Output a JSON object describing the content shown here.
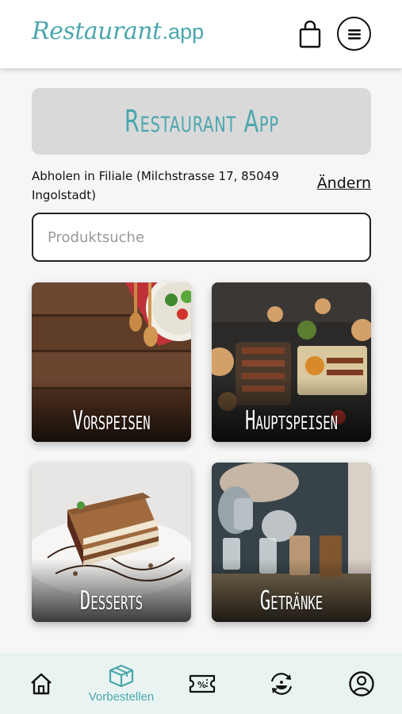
{
  "header": {
    "logo_main": "Restaurant",
    "logo_suffix": ".app",
    "cart_icon": "shopping-bag-icon",
    "menu_icon": "hamburger-menu-icon"
  },
  "banner": {
    "title": "Restaurant App"
  },
  "pickup": {
    "text": "Abholen in Filiale (Milchstrasse 17, 85049 Ingolstadt)",
    "change_label": "Ändern"
  },
  "search": {
    "placeholder": "Produktsuche",
    "value": ""
  },
  "categories": [
    {
      "label": "Vorspeisen"
    },
    {
      "label": "Hauptspeisen"
    },
    {
      "label": "Desserts"
    },
    {
      "label": "Getränke"
    }
  ],
  "bottom_nav": {
    "items": [
      {
        "icon": "home-icon",
        "label": ""
      },
      {
        "icon": "box-icon",
        "label": "Vorbestellen",
        "active": true
      },
      {
        "icon": "coupon-icon",
        "label": ""
      },
      {
        "icon": "refresh-dish-icon",
        "label": ""
      },
      {
        "icon": "account-icon",
        "label": ""
      }
    ]
  },
  "colors": {
    "accent": "#4aa7ad",
    "nav_bg": "#e9f4f2",
    "banner_bg": "#d9d9d9"
  }
}
